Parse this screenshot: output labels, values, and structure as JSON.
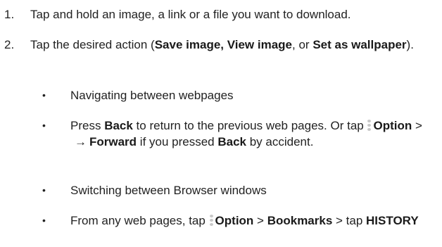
{
  "steps": [
    {
      "number": "1.",
      "text": "Tap and hold an image, a link or a file you want to download."
    },
    {
      "number": "2.",
      "text_before": "Tap the desired action (",
      "bold1": "Save image, View image",
      "text_mid": ", or ",
      "bold2": "Set as wallpaper",
      "text_after": ")."
    }
  ],
  "bullets": [
    {
      "marker": "•",
      "text": "Navigating between webpages"
    },
    {
      "marker": "•",
      "t1": "Press ",
      "b1": "Back",
      "t2": " to return to the previous web pages. Or tap ",
      "b2": "Option",
      "t3": " > ",
      "arrow": "→",
      "b3": "Forward",
      "t4": " if you pressed ",
      "b4": "Back",
      "t5": " by accident."
    },
    {
      "marker": "•",
      "text": "Switching between Browser windows"
    },
    {
      "marker": "•",
      "t1": "From any web pages, tap ",
      "b1": "Option",
      "t2": " > ",
      "b2": "Bookmarks",
      "t3": " > tap ",
      "b3": "HISTORY"
    }
  ],
  "icons": {
    "option": "vertical-dots-icon",
    "forward": "right-arrow-icon"
  },
  "colors": {
    "text": "#222222",
    "icon": "#c8c8c8"
  }
}
